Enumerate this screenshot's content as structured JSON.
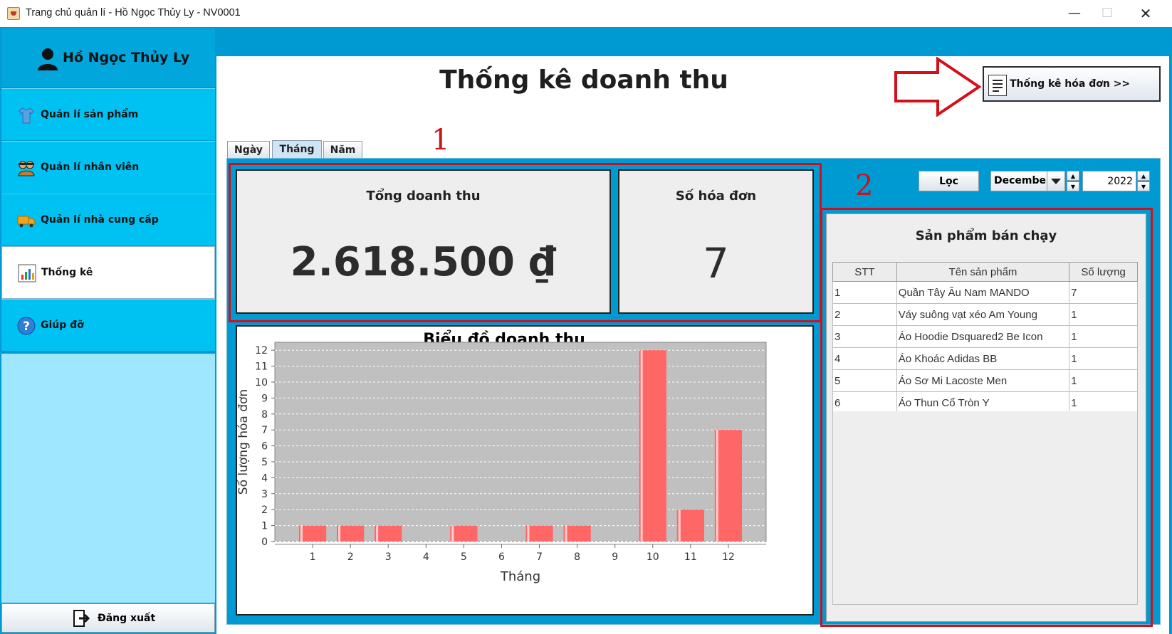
{
  "window": {
    "title": "Trang chủ quản lí - Hồ Ngọc Thủy Ly - NV0001",
    "minimize": "—",
    "maximize": "☐",
    "close": "✕"
  },
  "user": {
    "name": "Hồ Ngọc Thủy Ly"
  },
  "sidebar": {
    "items": [
      {
        "label": "Quản lí sản phẩm",
        "icon": "shirt-icon"
      },
      {
        "label": "Quản lí nhân viên",
        "icon": "people-icon"
      },
      {
        "label": "Quản lí nhà cung cấp",
        "icon": "truck-icon"
      },
      {
        "label": "Thống kê",
        "icon": "bar-chart-icon",
        "active": true
      },
      {
        "label": "Giúp đỡ",
        "icon": "help-icon"
      }
    ],
    "logout": "Đăng xuất"
  },
  "header": {
    "title": "Thống kê doanh thu",
    "invoice_button": "Thống kê hóa đơn >>"
  },
  "tabs": [
    "Ngày",
    "Tháng",
    "Năm"
  ],
  "active_tab": "Tháng",
  "annotations": [
    "1",
    "2"
  ],
  "summary": {
    "revenue_label": "Tổng doanh thu",
    "revenue_value": "2.618.500 ₫",
    "invoice_label": "Số hóa đơn",
    "invoice_value": "7"
  },
  "filter": {
    "button": "Lọc",
    "month": "December",
    "year": "2022"
  },
  "best_sellers": {
    "title": "Sản phẩm bán chạy",
    "columns": [
      "STT",
      "Tên sản phẩm",
      "Số lượng"
    ],
    "rows": [
      [
        "1",
        "Quần Tây Âu Nam MANDO",
        "7"
      ],
      [
        "2",
        "Váy suông vạt xéo Am Young",
        "1"
      ],
      [
        "3",
        "Áo Hoodie Dsquared2 Be Icon",
        "1"
      ],
      [
        "4",
        "Áo Khoác Adidas BB",
        "1"
      ],
      [
        "5",
        "Áo Sơ Mi Lacoste Men",
        "1"
      ],
      [
        "6",
        "Áo Thun Cổ Tròn Y",
        "1"
      ]
    ]
  },
  "colors": {
    "frame_blue": "#009ad2",
    "nav_blue": "#00c2f2",
    "bar_red": "#ff6666",
    "plot_bg": "#c0c0c0",
    "annotation_red": "#d40f1a"
  },
  "chart_data": {
    "type": "bar",
    "title": "Biểu đồ doanh thu",
    "xlabel": "Tháng",
    "ylabel": "Số lượng hóa đơn",
    "categories": [
      "1",
      "2",
      "3",
      "4",
      "5",
      "6",
      "7",
      "8",
      "9",
      "10",
      "11",
      "12"
    ],
    "values": [
      1,
      1,
      1,
      0,
      1,
      0,
      1,
      1,
      0,
      12,
      2,
      7
    ],
    "yticks": [
      "0",
      "1",
      "2",
      "3",
      "4",
      "5",
      "6",
      "7",
      "8",
      "9",
      "10",
      "11",
      "12"
    ],
    "ylim": [
      0,
      12.5
    ],
    "grid": true,
    "legend": "none"
  }
}
